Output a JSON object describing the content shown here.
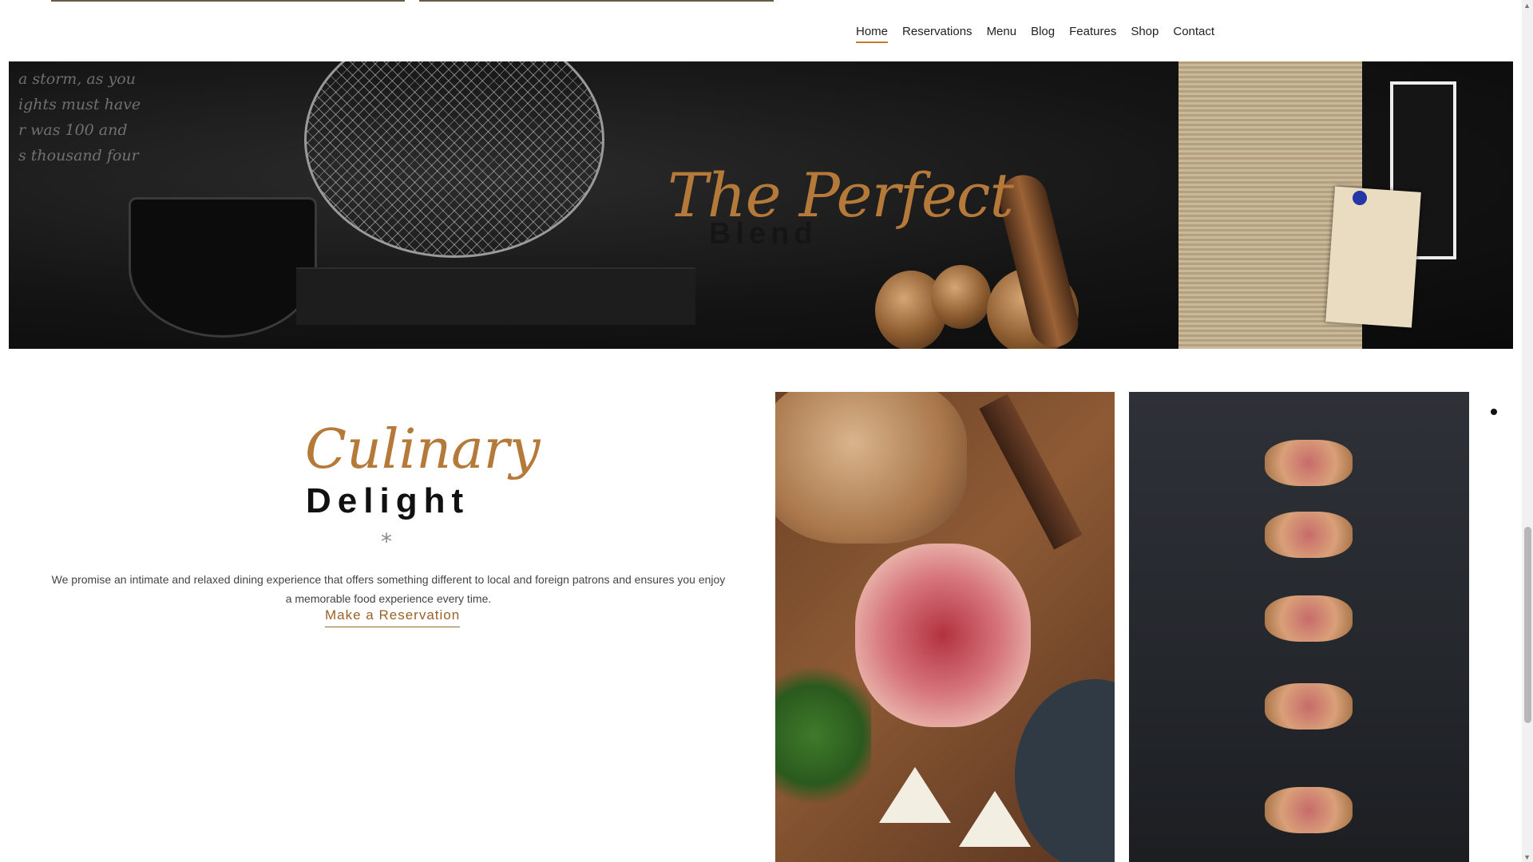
{
  "nav": {
    "items": [
      {
        "label": "Home",
        "active": true
      },
      {
        "label": "Reservations",
        "active": false
      },
      {
        "label": "Menu",
        "active": false
      },
      {
        "label": "Blog",
        "active": false
      },
      {
        "label": "Features",
        "active": false
      },
      {
        "label": "Shop",
        "active": false
      },
      {
        "label": "Contact",
        "active": false
      }
    ]
  },
  "banner": {
    "script_title": "The Perfect",
    "sub_title": "Blend",
    "chalk_lines": [
      "a storm, as you",
      "ights must have",
      "r was 100 and",
      "s thousand four"
    ]
  },
  "intro": {
    "script_title": "Culinary",
    "bold_title": "Delight",
    "divider": "*",
    "description": "We promise an intimate and relaxed dining experience that offers something different to local and foreign patrons and ensures you enjoy a memorable food experience every time.",
    "cta_label": "Make a Reservation"
  },
  "icons": {
    "divider": "asterisk-icon",
    "scroll_dot": "dot-icon"
  },
  "colors": {
    "accent": "#b5793a",
    "link": "#9a6226",
    "nav_active_underline": "#c77a2a",
    "text": "#444444"
  }
}
